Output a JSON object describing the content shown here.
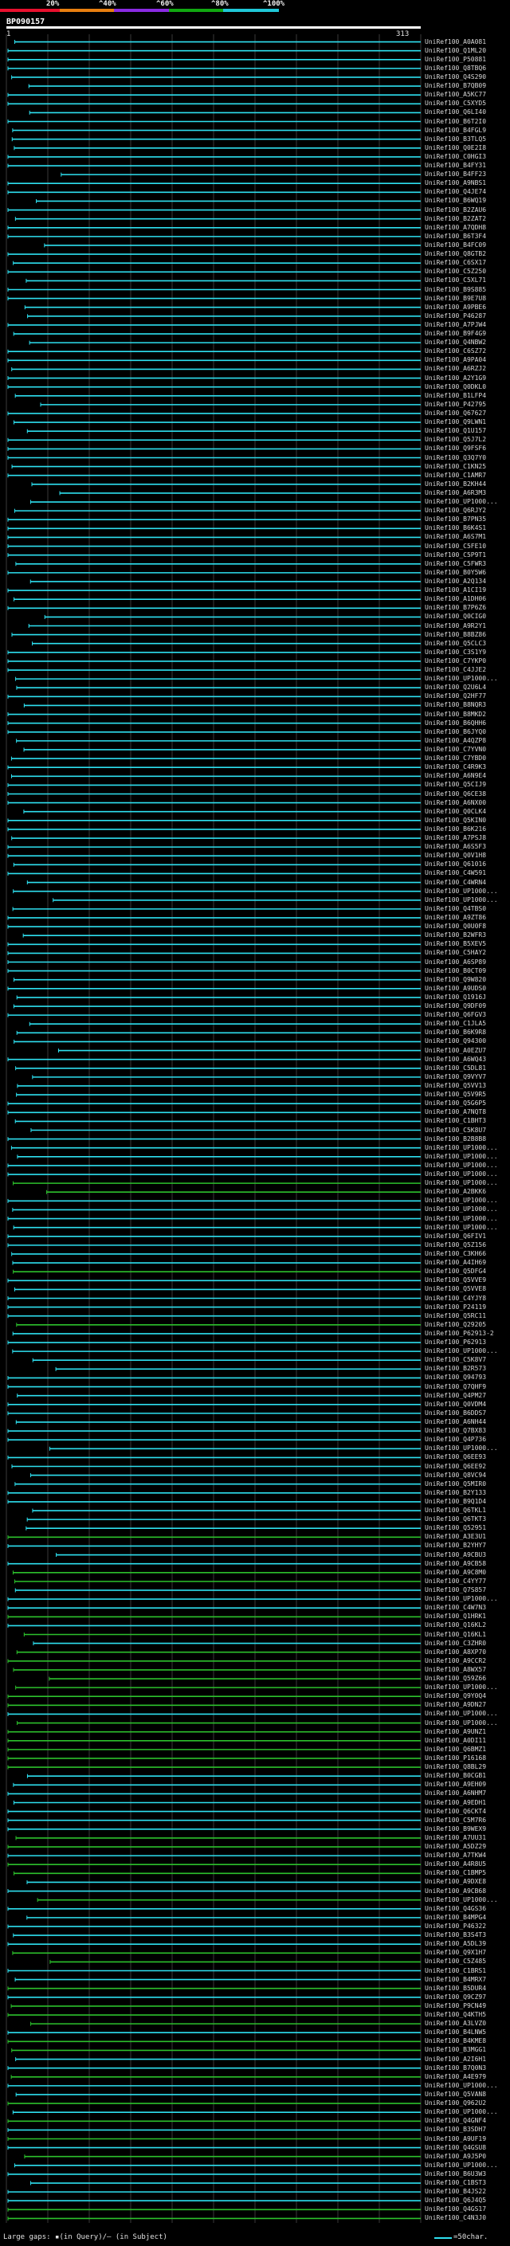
{
  "scale": {
    "percent_labels": [
      "20%",
      "^40%",
      "^60%",
      "^80%",
      "^100%"
    ],
    "colors": [
      "#e8102e",
      "#e87f10",
      "#8a2be2",
      "#11a811",
      "#20c8d8"
    ]
  },
  "query": {
    "name": "BP090157",
    "start": "1",
    "end": "313"
  },
  "colors": {
    "cyan_hit": "#2ee0f0",
    "green_hit": "#2cc12c",
    "grid": "#3a3a3a",
    "query_bar": "#ffffff"
  },
  "hits": [
    "UniRef100_A0A081",
    "UniRef100_Q1ML20",
    "UniRef100_P50881",
    "UniRef100_Q8TBQ6",
    "UniRef100_Q4S290",
    "UniRef100_B7QB09",
    "UniRef100_A5KC77",
    "UniRef100_C5XYD5",
    "UniRef100_Q6LI40",
    "UniRef100_B6T2I0",
    "UniRef100_B4FGL9",
    "UniRef100_B3TLQ5",
    "UniRef100_Q0E2I8",
    "UniRef100_C0HGI3",
    "UniRef100_B4FY31",
    "UniRef100_B4FF23",
    "UniRef100_A9NBS1",
    "UniRef100_Q4JE74",
    "UniRef100_B6WQ19",
    "UniRef100_B2ZAU6",
    "UniRef100_B2ZAT2",
    "UniRef100_A7QDH8",
    "UniRef100_B6T3F4",
    "UniRef100_B4FC09",
    "UniRef100_Q8GTB2",
    "UniRef100_C6SX17",
    "UniRef100_C5Z250",
    "UniRef100_C5XL71",
    "UniRef100_B9S885",
    "UniRef100_B9E7U8",
    "UniRef100_A9PBE6",
    "UniRef100_P46287",
    "UniRef100_A7PJW4",
    "UniRef100_B9F4G9",
    "UniRef100_Q4NBW2",
    "UniRef100_C6SZ72",
    "UniRef100_A9PA04",
    "UniRef100_A6RZJ2",
    "UniRef100_A2Y1G9",
    "UniRef100_Q0DKL0",
    "UniRef100_B1LFP4",
    "UniRef100_P42795",
    "UniRef100_Q67627",
    "UniRef100_Q9LWN1",
    "UniRef100_Q1U157",
    "UniRef100_Q5J7L2",
    "UniRef100_Q9FSF6",
    "UniRef100_Q3Q7Y0",
    "UniRef100_C1KN25",
    "UniRef100_C1AMR7",
    "UniRef100_B2KH44",
    "UniRef100_A6R3M3",
    "UniRef100_UP1000...",
    "UniRef100_Q6RJY2",
    "UniRef100_B7PN35",
    "UniRef100_B6K4S1",
    "UniRef100_A6S7M1",
    "UniRef100_C5FE10",
    "UniRef100_C5P9T1",
    "UniRef100_C5FWR3",
    "UniRef100_B0Y5W6",
    "UniRef100_A2Q134",
    "UniRef100_A1CI19",
    "UniRef100_A1DH06",
    "UniRef100_B7P6Z6",
    "UniRef100_Q0CIG0",
    "UniRef100_A9R2Y1",
    "UniRef100_B8BZ86",
    "UniRef100_Q5CLC3",
    "UniRef100_C3S1Y9",
    "UniRef100_C7YKP0",
    "UniRef100_C4JJE2",
    "UniRef100_UP1000...",
    "UniRef100_Q2U6L4",
    "UniRef100_Q2HF77",
    "UniRef100_B8NQR3",
    "UniRef100_B8MKD2",
    "UniRef100_B6QHH6",
    "UniRef100_B6JYQ0",
    "UniRef100_A4QZP8",
    "UniRef100_C7YVN0",
    "UniRef100_C7YBD0",
    "UniRef100_C4R9K3",
    "UniRef100_A6N9E4",
    "UniRef100_Q5CIJ9",
    "UniRef100_Q6CE38",
    "UniRef100_A6NX00",
    "UniRef100_Q0CLK4",
    "UniRef100_Q5KIN0",
    "UniRef100_B6K216",
    "UniRef100_A7PSJ8",
    "UniRef100_A6S5F3",
    "UniRef100_Q0V1H8",
    "UniRef100_Q61016",
    "UniRef100_C4W591",
    "UniRef100_C4WRN4",
    "UniRef100_UP1000...",
    "UniRef100_UP1000...",
    "UniRef100_Q4TBS0",
    "UniRef100_A9ZT86",
    "UniRef100_Q0U0F8",
    "UniRef100_B2WFR3",
    "UniRef100_B5XEV5",
    "UniRef100_C5HAY2",
    "UniRef100_A6SP89",
    "UniRef100_B0CT09",
    "UniRef100_Q9W820",
    "UniRef100_A9UDS0",
    "UniRef100_Q1916J",
    "UniRef100_Q9DF09",
    "UniRef100_Q6FGV3",
    "UniRef100_C1JLA5",
    "UniRef100_B6K9R8",
    "UniRef100_Q94300",
    "UniRef100_A0EZU7",
    "UniRef100_A6WQ43",
    "UniRef100_C5DL81",
    "UniRef100_Q9VYV7",
    "UniRef100_Q5VV13",
    "UniRef100_Q5V9R5",
    "UniRef100_Q5G6P5",
    "UniRef100_A7NQT8",
    "UniRef100_C1BHT3",
    "UniRef100_C5K8U7",
    "UniRef100_B2B8B8",
    "UniRef100_UP1000...",
    "UniRef100_UP1000...",
    "UniRef100_UP1000...",
    "UniRef100_UP1000...",
    "UniRef100_UP1000...",
    "UniRef100_A2BKK6",
    "UniRef100_UP1000...",
    "UniRef100_UP1000...",
    "UniRef100_UP1000...",
    "UniRef100_UP1000...",
    "UniRef100_Q6FIV1",
    "UniRef100_Q5Z156",
    "UniRef100_C3KH66",
    "UniRef100_A4IH69",
    "UniRef100_Q5DFG4",
    "UniRef100_Q5VVE9",
    "UniRef100_Q5VVE8",
    "UniRef100_C4YJY8",
    "UniRef100_P24119",
    "UniRef100_Q5RC11",
    "UniRef100_Q29205",
    "UniRef100_P62913-2",
    "UniRef100_P62913",
    "UniRef100_UP1000...",
    "UniRef100_C5K8V7",
    "UniRef100_B2R573",
    "UniRef100_Q94793",
    "UniRef100_Q7QHF9",
    "UniRef100_Q4PM27",
    "UniRef100_Q0VDM4",
    "UniRef100_B6DDS7",
    "UniRef100_A6NH44",
    "UniRef100_Q7BX83",
    "UniRef100_Q4P736",
    "UniRef100_UP1000...",
    "UniRef100_Q6EE93",
    "UniRef100_Q6EE92",
    "UniRef100_Q8VC94",
    "UniRef100_Q5MIR0",
    "UniRef100_B2Y133",
    "UniRef100_B9Q1D4",
    "UniRef100_Q6TKL1",
    "UniRef100_Q6TKT3",
    "UniRef100_Q52951",
    "UniRef100_A3E3U1",
    "UniRef100_B2YHY7",
    "UniRef100_A9CBU3",
    "UniRef100_A9CB58",
    "UniRef100_A9C8M0",
    "UniRef100_C4YY77",
    "UniRef100_Q7S857",
    "UniRef100_UP1000...",
    "UniRef100_C4W7N3",
    "UniRef100_Q1HRK1",
    "UniRef100_Q16KL2",
    "UniRef100_Q16KL1",
    "UniRef100_C3ZHR0",
    "UniRef100_A8XP70",
    "UniRef100_A9CCR2",
    "UniRef100_A8WX57",
    "UniRef100_Q59Z66",
    "UniRef100_UP1000...",
    "UniRef100_Q9Y0Q4",
    "UniRef100_A9DN27",
    "UniRef100_UP1000...",
    "UniRef100_UP1000...",
    "UniRef100_A9UNZ1",
    "UniRef100_A0DI11",
    "UniRef100_Q6BMZ1",
    "UniRef100_P16168",
    "UniRef100_Q8BL29",
    "UniRef100_B0CGB1",
    "UniRef100_A9EH09",
    "UniRef100_A6NHM7",
    "UniRef100_A9EDH1",
    "UniRef100_Q6CKT4",
    "UniRef100_C5M7R6",
    "UniRef100_B9WEX9",
    "UniRef100_A7UU31",
    "UniRef100_A5DZ29",
    "UniRef100_A7TKW4",
    "UniRef100_A4R8U5",
    "UniRef100_C1BMP5",
    "UniRef100_A9DXE8",
    "UniRef100_A9CB68",
    "UniRef100_UP1000...",
    "UniRef100_Q4GS36",
    "UniRef100_B4MPG4",
    "UniRef100_P46322",
    "UniRef100_B3S4T3",
    "UniRef100_A5DL39",
    "UniRef100_Q9X1H7",
    "UniRef100_C5Z485",
    "UniRef100_C1BRS1",
    "UniRef100_B4MRX7",
    "UniRef100_B5DUR4",
    "UniRef100_Q9CZ97",
    "UniRef100_P9CN49",
    "UniRef100_Q4KTH5",
    "UniRef100_A3LVZ0",
    "UniRef100_B4LNW5",
    "UniRef100_B4KME8",
    "UniRef100_B3MGG1",
    "UniRef100_A2I6H1",
    "UniRef100_B7Q0N3",
    "UniRef100_A4E979",
    "UniRef100_UP1000...",
    "UniRef100_Q5VAN8",
    "UniRef100_Q962U2",
    "UniRef100_UP1000...",
    "UniRef100_Q4GNF4",
    "UniRef100_B3SDH7",
    "UniRef100_A9UF19",
    "UniRef100_Q4GSU8",
    "UniRef100_A9J5P0",
    "UniRef100_UP1000...",
    "UniRef100_B6U3W3",
    "UniRef100_C1BST3",
    "UniRef100_B4JS22",
    "UniRef100_Q6J4Q5",
    "UniRef100_Q4GS17",
    "UniRef100_C4N3J0"
  ],
  "legend": {
    "gap_text": "Large gaps: ▪(in Query)/– (in Subject)",
    "scale_text": "=50char."
  }
}
